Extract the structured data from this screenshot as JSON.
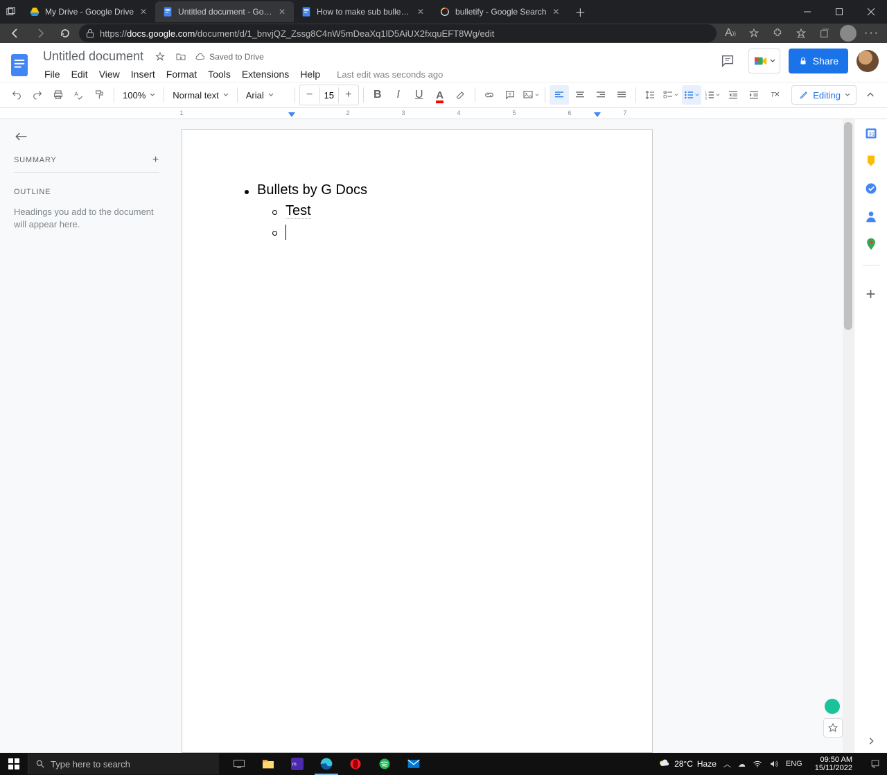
{
  "browser": {
    "tabs": [
      {
        "title": "My Drive - Google Drive"
      },
      {
        "title": "Untitled document - Google Docs"
      },
      {
        "title": "How to make sub bullet points in"
      },
      {
        "title": "bulletify - Google Search"
      }
    ],
    "url_host": "docs.google.com",
    "url_path": "/document/d/1_bnvjQZ_Zssg8C4nW5mDeaXq1lD5AiUX2fxquEFT8Wg/edit"
  },
  "doc": {
    "title": "Untitled document",
    "saved_label": "Saved to Drive",
    "menu": {
      "file": "File",
      "edit": "Edit",
      "view": "View",
      "insert": "Insert",
      "format": "Format",
      "tools": "Tools",
      "extensions": "Extensions",
      "help": "Help"
    },
    "last_edit": "Last edit was seconds ago",
    "share": "Share"
  },
  "toolbar": {
    "zoom": "100%",
    "style": "Normal text",
    "font": "Arial",
    "fontsize": "15",
    "edit_mode": "Editing"
  },
  "outline": {
    "summary": "SUMMARY",
    "outline": "OUTLINE",
    "hint": "Headings you add to the document will appear here."
  },
  "content": {
    "l1": "Bullets by G Docs",
    "l2a": "Test"
  },
  "ruler": {
    "n1": "1",
    "n2": "2",
    "n3": "3",
    "n4": "4",
    "n5": "5",
    "n6": "6",
    "n7": "7"
  },
  "taskbar": {
    "search_placeholder": "Type here to search",
    "temp": "28°C",
    "weather": "Haze",
    "lang": "ENG",
    "time": "09:50 AM",
    "date": "15/11/2022"
  }
}
